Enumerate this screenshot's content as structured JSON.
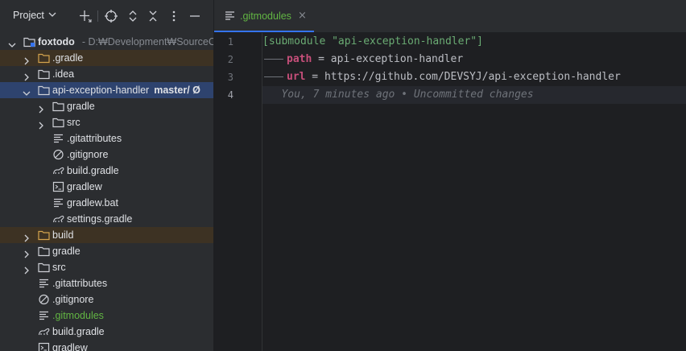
{
  "project_panel": {
    "title": "Project",
    "tree": [
      {
        "label": "foxtodo",
        "hint": "- D:₩Development₩SourceCo",
        "depth": 0,
        "arrow": "down",
        "icon": "module-folder",
        "style": "bold"
      },
      {
        "label": ".gradle",
        "depth": 1,
        "arrow": "right",
        "icon": "folder-orange",
        "excluded": true
      },
      {
        "label": ".idea",
        "depth": 1,
        "arrow": "right",
        "icon": "folder"
      },
      {
        "label": "api-exception-handler",
        "branch": "master/ Ø",
        "depth": 1,
        "arrow": "down",
        "icon": "folder",
        "selected": true
      },
      {
        "label": "gradle",
        "depth": 2,
        "arrow": "right",
        "icon": "folder"
      },
      {
        "label": "src",
        "depth": 2,
        "arrow": "right",
        "icon": "folder"
      },
      {
        "label": ".gitattributes",
        "depth": 2,
        "icon": "text-file"
      },
      {
        "label": ".gitignore",
        "depth": 2,
        "icon": "ignore-file"
      },
      {
        "label": "build.gradle",
        "depth": 2,
        "icon": "gradle-file"
      },
      {
        "label": "gradlew",
        "depth": 2,
        "icon": "shell-file"
      },
      {
        "label": "gradlew.bat",
        "depth": 2,
        "icon": "text-file"
      },
      {
        "label": "settings.gradle",
        "depth": 2,
        "icon": "gradle-file"
      },
      {
        "label": "build",
        "depth": 1,
        "arrow": "right",
        "icon": "folder-orange",
        "excluded": true
      },
      {
        "label": "gradle",
        "depth": 1,
        "arrow": "right",
        "icon": "folder"
      },
      {
        "label": "src",
        "depth": 1,
        "arrow": "right",
        "icon": "folder"
      },
      {
        "label": ".gitattributes",
        "depth": 1,
        "icon": "text-file"
      },
      {
        "label": ".gitignore",
        "depth": 1,
        "icon": "ignore-file"
      },
      {
        "label": ".gitmodules",
        "depth": 1,
        "icon": "text-file",
        "style": "green"
      },
      {
        "label": "build.gradle",
        "depth": 1,
        "icon": "gradle-file"
      },
      {
        "label": "gradlew",
        "depth": 1,
        "icon": "shell-file"
      }
    ]
  },
  "editor": {
    "tab": {
      "label": ".gitmodules",
      "close": "×"
    },
    "line_numbers": [
      "1",
      "2",
      "3",
      "4"
    ],
    "current_line": 4,
    "lines": [
      {
        "parts": [
          {
            "t": "[submodule \"api-exception-handler\"]",
            "c": "sec"
          }
        ]
      },
      {
        "indent": true,
        "parts": [
          {
            "t": "path",
            "c": "key"
          },
          {
            "t": " = api-exception-handler",
            "c": "text"
          }
        ]
      },
      {
        "indent": true,
        "parts": [
          {
            "t": "url",
            "c": "key"
          },
          {
            "t": " = https://github.com/DEVSYJ/api-exception-handler",
            "c": "text"
          }
        ]
      },
      {
        "parts": [
          {
            "t": "   You, 7 minutes ago • Uncommitted changes",
            "c": "ghost"
          }
        ]
      }
    ]
  },
  "colors": {
    "accent": "#3574f0",
    "selection": "#2e436e",
    "excluded": "#3d3223",
    "modified": "#62b543"
  }
}
